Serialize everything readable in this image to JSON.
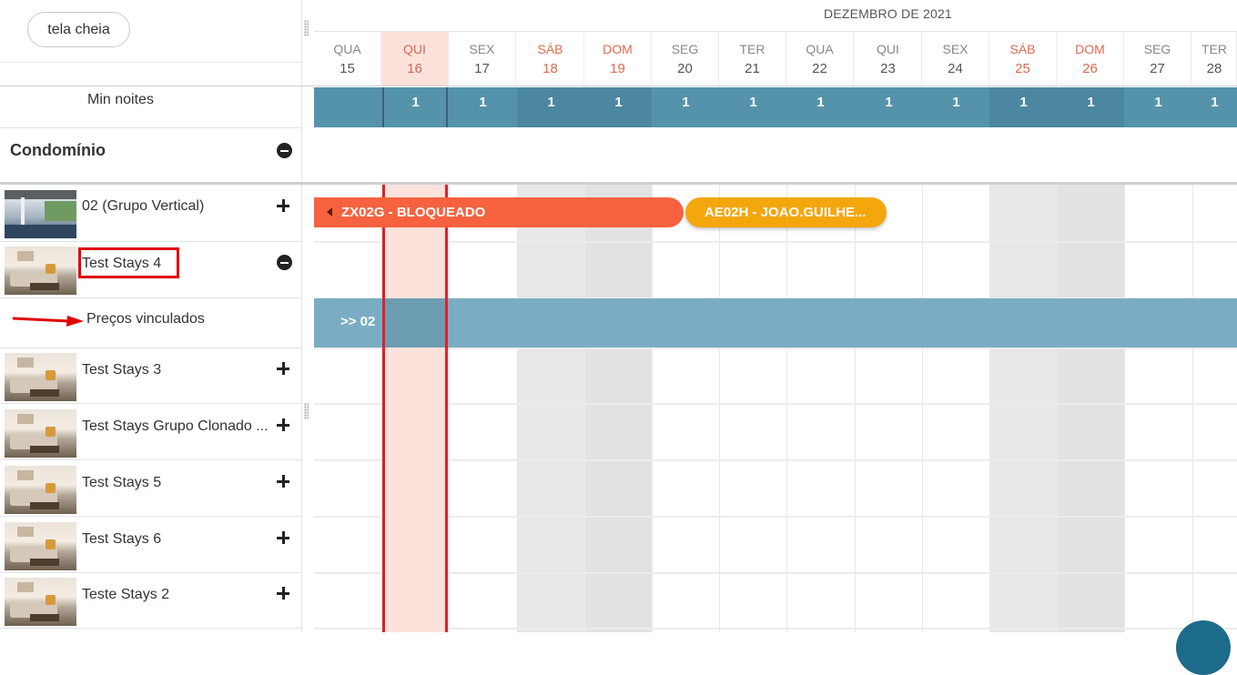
{
  "toolbar": {
    "fullscreen_label": "tela cheia"
  },
  "calendar": {
    "month_label": "DEZEMBRO DE 2021",
    "days": [
      {
        "weekday": "QUA",
        "day": "15",
        "weekend": false,
        "today": false
      },
      {
        "weekday": "QUI",
        "day": "16",
        "weekend": false,
        "today": true
      },
      {
        "weekday": "SEX",
        "day": "17",
        "weekend": false,
        "today": false
      },
      {
        "weekday": "SÁB",
        "day": "18",
        "weekend": true,
        "today": false
      },
      {
        "weekday": "DOM",
        "day": "19",
        "weekend": true,
        "today": false
      },
      {
        "weekday": "SEG",
        "day": "20",
        "weekend": false,
        "today": false
      },
      {
        "weekday": "TER",
        "day": "21",
        "weekend": false,
        "today": false
      },
      {
        "weekday": "QUA",
        "day": "22",
        "weekend": false,
        "today": false
      },
      {
        "weekday": "QUI",
        "day": "23",
        "weekend": false,
        "today": false
      },
      {
        "weekday": "SEX",
        "day": "24",
        "weekend": false,
        "today": false
      },
      {
        "weekday": "SÁB",
        "day": "25",
        "weekend": true,
        "today": false
      },
      {
        "weekday": "DOM",
        "day": "26",
        "weekend": true,
        "today": false
      },
      {
        "weekday": "SEG",
        "day": "27",
        "weekend": false,
        "today": false
      },
      {
        "weekday": "TER",
        "day": "28",
        "weekend": false,
        "today": false
      }
    ],
    "min_nights_values": [
      "",
      "1",
      "1",
      "1",
      "1",
      "1",
      "1",
      "1",
      "1",
      "1",
      "1",
      "1",
      "1",
      "1"
    ]
  },
  "sidebar": {
    "min_nights_label": "Min noites",
    "group_title": "Condomínio",
    "units": [
      {
        "name": "02 (Grupo Vertical)",
        "icon": "plus-icon"
      },
      {
        "name": "Test Stays 4",
        "icon": "minus-icon"
      },
      {
        "name": "Test Stays 3",
        "icon": "plus-icon"
      },
      {
        "name": "Test Stays Grupo Clonado ...",
        "icon": "plus-icon"
      },
      {
        "name": "Test Stays 5",
        "icon": "plus-icon"
      },
      {
        "name": "Test Stays 6",
        "icon": "plus-icon"
      },
      {
        "name": "Teste Stays 2",
        "icon": "plus-icon"
      }
    ],
    "linked_prices_label": "Preços vinculados"
  },
  "bookings": [
    {
      "label": "ZX02G - BLOQUEADO",
      "color": "#f6623f"
    },
    {
      "label": "AE02H - JOAO.GUILHE...",
      "color": "#f4a60d"
    }
  ],
  "linked_band_label": ">> 02",
  "colors": {
    "min_nights_bar": "#5593ab",
    "today_highlight": "#fde2dc",
    "today_border": "#e0202a",
    "weekend_text": "#e0694c",
    "linked_band": "#7aadc3",
    "annotation_red": "#e00000"
  }
}
